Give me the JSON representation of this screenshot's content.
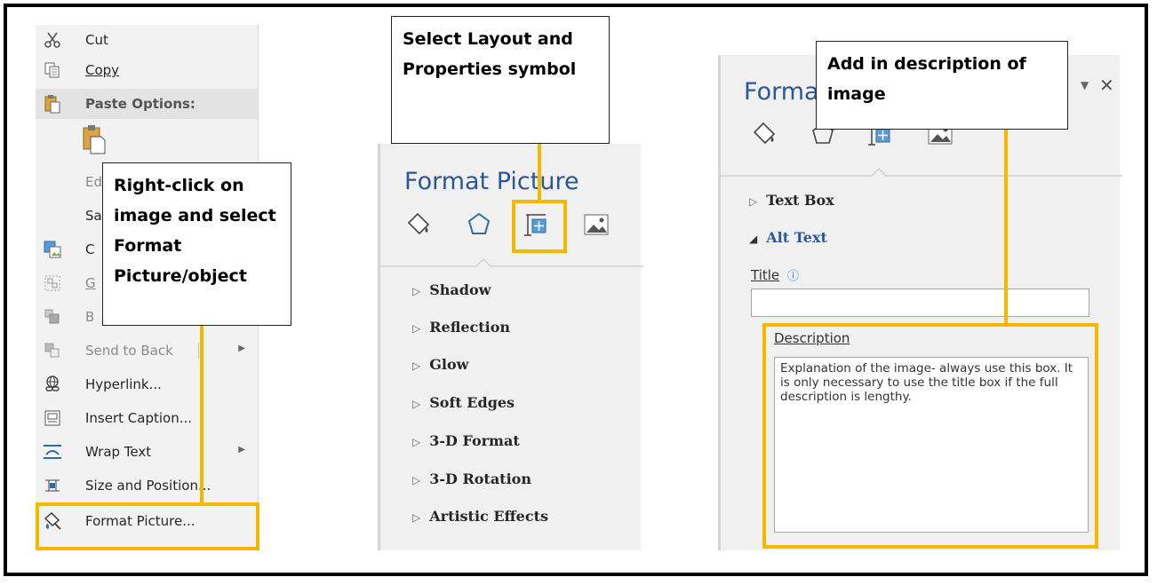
{
  "context_menu": {
    "items": [
      {
        "label": "Cut",
        "icon": "scissors-icon"
      },
      {
        "label": "Copy",
        "icon": "copy-icon"
      },
      {
        "label": "Paste Options:",
        "icon": "paste-icon"
      },
      {
        "label": "Ed",
        "icon": ""
      },
      {
        "label": "Sa",
        "icon": ""
      },
      {
        "label": "C",
        "icon": "change-picture-icon"
      },
      {
        "label": "G",
        "icon": "group-icon"
      },
      {
        "label": "B",
        "icon": "bring-to-front-icon"
      },
      {
        "label": "Send to Back",
        "icon": "send-to-back-icon"
      },
      {
        "label": "Hyperlink...",
        "icon": "hyperlink-icon"
      },
      {
        "label": "Insert Caption...",
        "icon": "insert-caption-icon"
      },
      {
        "label": "Wrap Text",
        "icon": "wrap-text-icon"
      },
      {
        "label": "Size and Position...",
        "icon": "size-position-icon"
      },
      {
        "label": "Format Picture...",
        "icon": "format-picture-icon"
      }
    ]
  },
  "callouts": {
    "right_click": "Right-click on image and select Format Picture/object",
    "layout": "Select Layout and Properties symbol",
    "description": "Add in description of image"
  },
  "format_panel": {
    "title": "Format Picture",
    "icons": [
      "fill-line-icon",
      "effects-icon",
      "layout-properties-icon",
      "picture-icon"
    ],
    "sections": [
      "Shadow",
      "Reflection",
      "Glow",
      "Soft Edges",
      "3-D Format",
      "3-D Rotation",
      "Artistic Effects"
    ]
  },
  "alt_text_panel": {
    "title_partial": "Forma",
    "close_glyph": "✕",
    "sections": {
      "text_box": "Text Box",
      "alt_text": "Alt Text"
    },
    "title_field_label": "Title",
    "title_value": "",
    "description_label": "Description",
    "description_value": "Explanation of the image- always use this box. It is only necessary to use the title box if the full description is lengthy."
  },
  "colors": {
    "highlight": "#f5b800",
    "panel_title": "#2b579a",
    "alt_text_heading": "#2b579a"
  }
}
